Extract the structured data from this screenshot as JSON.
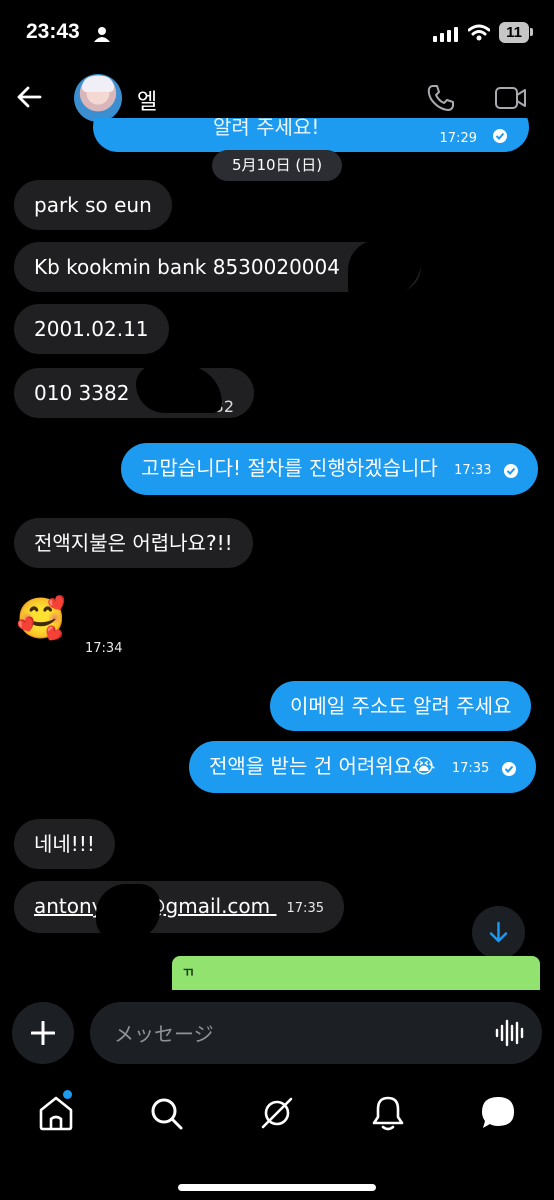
{
  "status_bar": {
    "time": "23:43",
    "battery": "11"
  },
  "header": {
    "contact_name": "엘",
    "back_icon": "arrow-left-icon",
    "call_icon": "phone-icon",
    "video_icon": "video-camera-icon"
  },
  "chat": {
    "top_partial": {
      "text": "알려 주세요!",
      "time": "17:29"
    },
    "date_separator": "5月10日 (日)",
    "messages": [
      {
        "text": "park so eun"
      },
      {
        "text": "Kb kookmin bank 8530020004"
      },
      {
        "text": "2001.02.11"
      },
      {
        "text": "010 3382",
        "trailing": "32"
      },
      {
        "text": "고맙습니다! 절차를 진행하겠습니다",
        "time": "17:33"
      },
      {
        "text": "전액지불은 어렵나요?!!"
      },
      {
        "text": "🥰",
        "time": "17:34"
      },
      {
        "text": "이메일 주소도 알려 주세요"
      },
      {
        "text": "전액을 받는 건 어려워요😭",
        "time": "17:35"
      },
      {
        "text": "네네!!!"
      },
      {
        "link_start": "antony",
        "link_end": "@gmail.com",
        "time": "17:35"
      },
      {
        "text": "ㄲ"
      }
    ]
  },
  "composer": {
    "placeholder": "メッセージ"
  },
  "nav": {
    "items": [
      "home-icon",
      "search-icon",
      "grok-icon",
      "bell-icon",
      "messages-icon"
    ]
  },
  "colors": {
    "accent": "#1d9bf0",
    "incoming": "#202022",
    "background": "#000000"
  }
}
